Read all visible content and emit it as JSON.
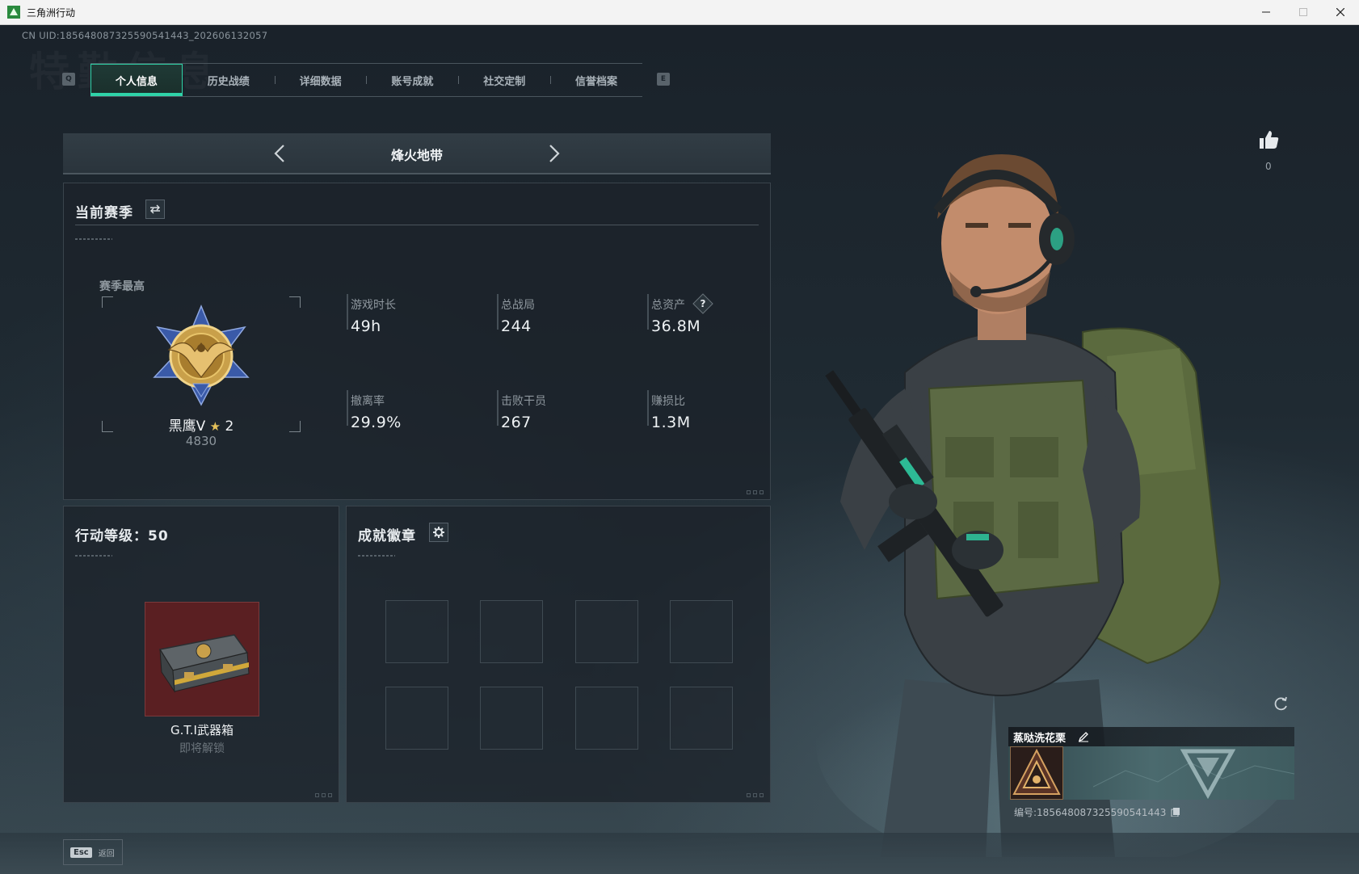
{
  "window": {
    "title": "三角洲行动",
    "controls": [
      "minimize",
      "maximize",
      "close"
    ]
  },
  "uid": "CN UID:185648087325590541443_202606132057",
  "background_watermark": "特勤信息",
  "tabs": {
    "left_key": "Q",
    "right_key": "E",
    "items": [
      {
        "label": "个人信息",
        "active": true
      },
      {
        "label": "历史战绩",
        "active": false
      },
      {
        "label": "详细数据",
        "active": false
      },
      {
        "label": "账号成就",
        "active": false
      },
      {
        "label": "社交定制",
        "active": false
      },
      {
        "label": "信誉档案",
        "active": false
      }
    ]
  },
  "mode_selector": {
    "title": "烽火地带"
  },
  "season": {
    "header": "当前赛季",
    "best_label": "赛季最高",
    "rank_name": "黑鹰V",
    "rank_stars": "2",
    "rank_score": "4830",
    "stats": [
      {
        "label": "游戏时长",
        "value": "49h"
      },
      {
        "label": "总战局",
        "value": "244"
      },
      {
        "label": "总资产",
        "value": "36.8M",
        "has_help": true
      },
      {
        "label": "撤离率",
        "value": "29.9%"
      },
      {
        "label": "击败干员",
        "value": "267"
      },
      {
        "label": "赚损比",
        "value": "1.3M"
      }
    ],
    "help_glyph": "?"
  },
  "level_panel": {
    "header": "行动等级：50",
    "reward_name": "G.T.I武器箱",
    "reward_status": "即将解锁"
  },
  "achievements": {
    "header": "成就徽章",
    "empty_slots": 8
  },
  "player_card": {
    "like_count": "0",
    "name": "蒸哒洗花栗",
    "id_text": "编号:185648087325590541443"
  },
  "footer": {
    "esc_key": "Esc",
    "esc_label": "返回"
  },
  "colors": {
    "accent": "#2fd3a8",
    "panel_bg": "#1c232a",
    "reward_bg": "#5a1f22",
    "badge_gold": "#c9a04a",
    "badge_blue": "#3a5aa8"
  }
}
